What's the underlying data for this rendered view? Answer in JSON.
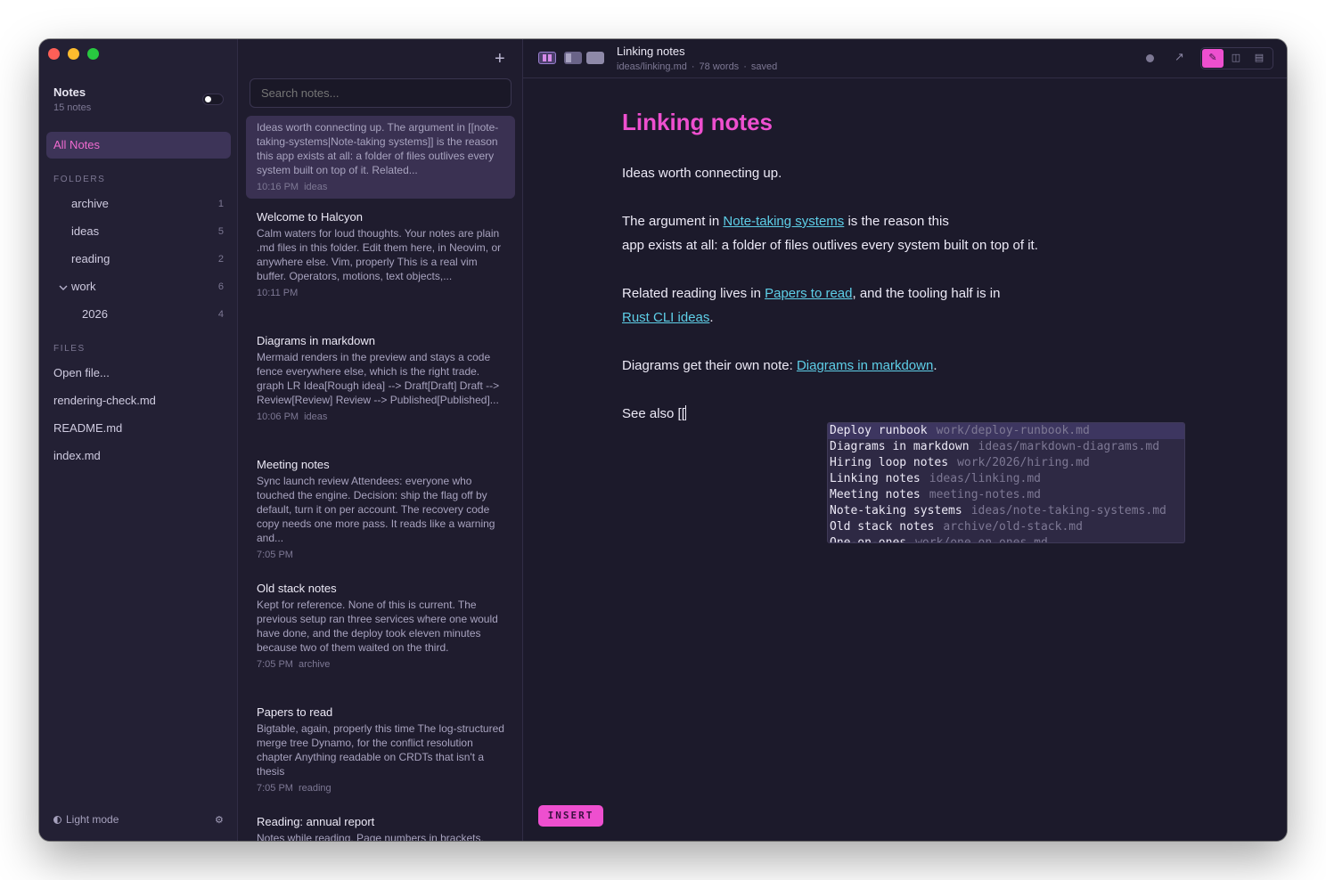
{
  "sidebar": {
    "title": "Notes",
    "count": "15 notes",
    "all_notes": "All Notes",
    "folders_heading": "FOLDERS",
    "folders": [
      {
        "name": "archive",
        "count": "1"
      },
      {
        "name": "ideas",
        "count": "5"
      },
      {
        "name": "reading",
        "count": "2"
      },
      {
        "name": "work",
        "count": "6"
      },
      {
        "name": "2026",
        "count": "4"
      }
    ],
    "files_heading": "FILES",
    "files": [
      "Open file...",
      "rendering-check.md",
      "README.md",
      "index.md"
    ],
    "light_mode": "Light mode"
  },
  "notelist": {
    "plus": "+",
    "search_placeholder": "Search notes...",
    "notes": [
      {
        "title": "",
        "body": "Ideas worth connecting up. The argument in [[note-taking-systems|Note-taking systems]] is the reason this app exists at all: a folder of files outlives every system built on top of it. Related...",
        "time": "10:16 PM",
        "tag": "ideas"
      },
      {
        "title": "Welcome to Halcyon",
        "body": "Calm waters for loud thoughts. Your notes are plain .md files in this folder. Edit them here, in Neovim, or anywhere else. Vim, properly This is a real vim buffer. Operators, motions, text objects,...",
        "time": "10:11 PM",
        "tag": ""
      },
      {
        "title": "Diagrams in markdown",
        "body": "Mermaid renders in the preview and stays a code fence everywhere else, which is the right trade. graph LR Idea[Rough idea] --> Draft[Draft] Draft --> Review[Review] Review --> Published[Published]...",
        "time": "10:06 PM",
        "tag": "ideas"
      },
      {
        "title": "Meeting notes",
        "body": "Sync launch review Attendees: everyone who touched the engine. Decision: ship the flag off by default, turn it on per account. The recovery code copy needs one more pass. It reads like a warning and...",
        "time": "7:05 PM",
        "tag": ""
      },
      {
        "title": "Old stack notes",
        "body": "Kept for reference. None of this is current. The previous setup ran three services where one would have done, and the deploy took eleven minutes because two of them waited on the third.",
        "time": "7:05 PM",
        "tag": "archive"
      },
      {
        "title": "Papers to read",
        "body": "Bigtable, again, properly this time The log-structured merge tree Dynamo, for the conflict resolution chapter Anything readable on CRDTs that isn't a thesis",
        "time": "7:05 PM",
        "tag": "reading"
      },
      {
        "title": "Reading: annual report",
        "body": "Notes while reading. Page numbers in brackets.",
        "time": "",
        "tag": ""
      }
    ]
  },
  "editor": {
    "doc_title": "Linking notes",
    "doc_path": "ideas/linking.md",
    "word_count": "78 words",
    "status": "saved",
    "heading": "Linking notes",
    "p1": "Ideas worth connecting up.",
    "p2": {
      "pre": "The argument in ",
      "link": "Note-taking systems",
      "post": " is the reason this",
      "line2": "app exists at all: a folder of files outlives every system built on top of it."
    },
    "p3": {
      "pre": "Related reading lives in ",
      "link1": "Papers to read",
      "mid": ", and the tooling half is in",
      "link2": "Rust CLI ideas",
      "post": "."
    },
    "p4": {
      "pre": "Diagrams get their own note: ",
      "link": "Diagrams in markdown",
      "post": "."
    },
    "p5": "See also [[",
    "completions": [
      {
        "title": "Deploy runbook",
        "path": "work/deploy-runbook.md"
      },
      {
        "title": "Diagrams in markdown",
        "path": "ideas/markdown-diagrams.md"
      },
      {
        "title": "Hiring loop notes",
        "path": "work/2026/hiring.md"
      },
      {
        "title": "Linking notes",
        "path": "ideas/linking.md"
      },
      {
        "title": "Meeting notes",
        "path": "meeting-notes.md"
      },
      {
        "title": "Note-taking systems",
        "path": "ideas/note-taking-systems.md"
      },
      {
        "title": "Old stack notes",
        "path": "archive/old-stack.md"
      },
      {
        "title": "One-on-ones",
        "path": "work/one-on-ones.md"
      }
    ],
    "mode": "INSERT"
  },
  "colors": {
    "accent": "#ee4fcf",
    "link": "#5ecfe8",
    "background": "#1c1a2b"
  }
}
